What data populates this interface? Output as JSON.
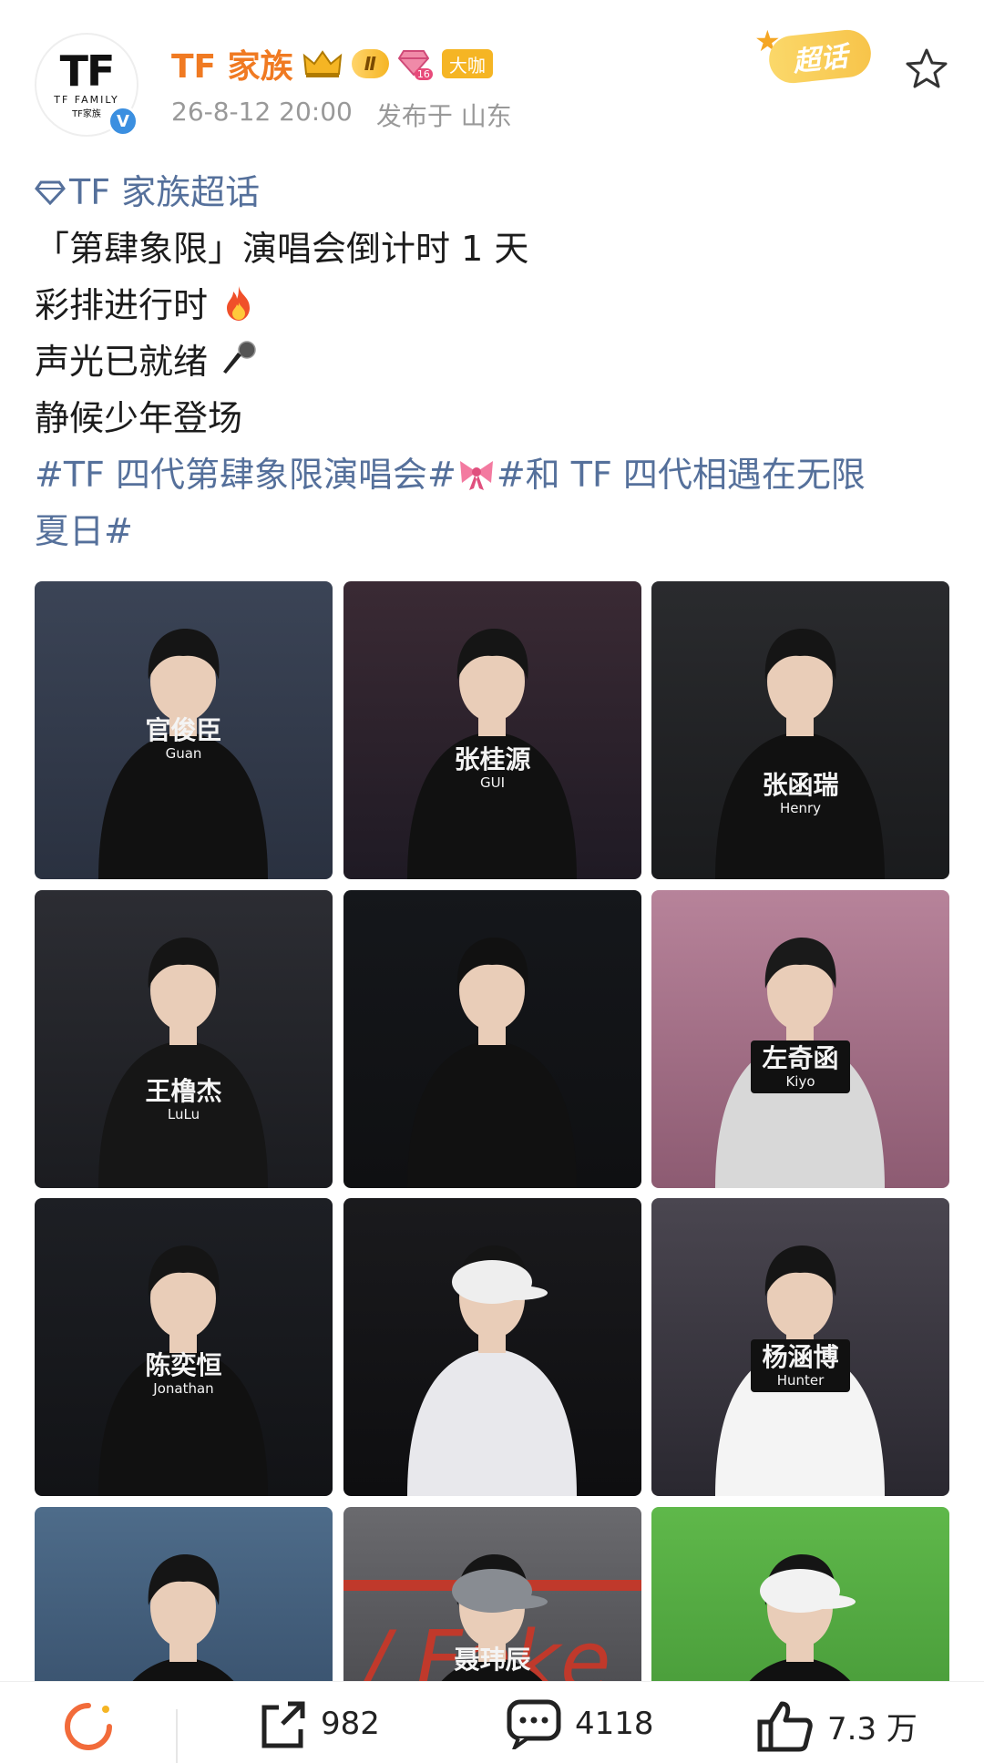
{
  "header": {
    "avatar_logo": "TF",
    "avatar_text": "TF FAMILY",
    "avatar_sub": "TF家族",
    "verified_mark": "V",
    "username": "TF 家族",
    "level_badge": "Ⅱ",
    "gem_level": "16",
    "tag_badge": "大咖",
    "timestamp": "26-8-12 20:00",
    "location": "发布于 山东",
    "chaohua_label": "超话"
  },
  "post": {
    "topic": "TF 家族超话",
    "lines": [
      "「第肆象限」演唱会倒计时 1 天",
      "彩排进行时",
      "声光已就绪",
      "静候少年登场"
    ],
    "hashtag_1": "#TF 四代第肆象限演唱会#",
    "hashtag_2_a": "#和 TF 四代相遇在无限",
    "hashtag_2_b": "夏日#"
  },
  "photos": [
    {
      "shirt_cn": "官俊臣",
      "shirt_en": "Guan"
    },
    {
      "shirt_cn": "张桂源",
      "shirt_en": "GUI"
    },
    {
      "shirt_cn": "张函瑞",
      "shirt_en": "Henry"
    },
    {
      "shirt_cn": "王橹杰",
      "shirt_en": "LuLu"
    },
    {
      "shirt_cn": "",
      "shirt_en": ""
    },
    {
      "shirt_cn": "左奇函",
      "shirt_en": "Kiyo"
    },
    {
      "shirt_cn": "陈奕恒",
      "shirt_en": "Jonathan"
    },
    {
      "shirt_cn": "",
      "shirt_en": ""
    },
    {
      "shirt_cn": "杨涵博",
      "shirt_en": "Hunter"
    },
    {
      "shirt_cn": "",
      "shirt_en": ""
    },
    {
      "shirt_cn": "聂玮辰",
      "shirt_en": ""
    },
    {
      "shirt_cn": "",
      "shirt_en": ""
    }
  ],
  "actions": {
    "repost_count": "982",
    "comment_count": "4118",
    "like_count": "7.3 万"
  },
  "colors": {
    "username": "#f07a22",
    "link": "#55709b",
    "meta": "#999999"
  }
}
